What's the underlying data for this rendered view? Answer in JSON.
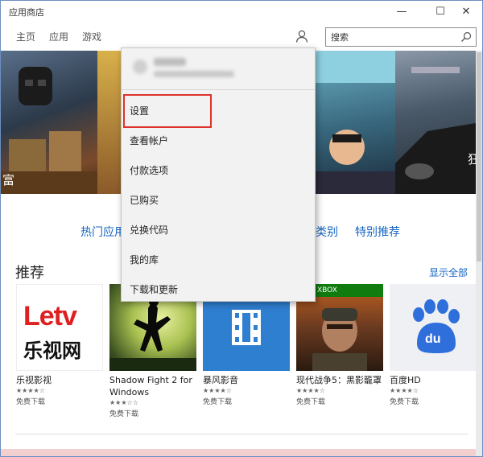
{
  "window": {
    "title": "应用商店",
    "minimize": "—",
    "maximize": "☐",
    "close": "✕"
  },
  "nav": {
    "items": [
      "主页",
      "应用",
      "游戏"
    ],
    "search_placeholder": "搜索"
  },
  "hero": {
    "captions": [
      "富",
      "狂"
    ]
  },
  "categories": {
    "hot": "热门应用",
    "categories": "类别",
    "featured": "特别推荐"
  },
  "recommended": {
    "title": "推荐",
    "show_all": "显示全部",
    "apps": [
      {
        "name": "乐视影视",
        "stars": "★★★★☆",
        "price": "免费下载",
        "logo_top": "Letv",
        "logo_bottom": "乐视网"
      },
      {
        "name": "Shadow Fight 2 for Windows",
        "stars": "★★★☆☆",
        "price": "免费下载"
      },
      {
        "name": "暴风影音",
        "stars": "★★★★☆",
        "price": "免费下载"
      },
      {
        "name": "现代战争5：黑影籠罩",
        "stars": "★★★★☆",
        "price": "免费下载",
        "badge": "XBOX"
      },
      {
        "name": "百度HD",
        "stars": "★★★★☆",
        "price": "免费下载",
        "logo": "du"
      }
    ]
  },
  "menu": {
    "items": [
      "设置",
      "查看帐户",
      "付款选项",
      "已购买",
      "兑换代码",
      "我的库",
      "下载和更新"
    ]
  },
  "colors": {
    "accent_link": "#1565c0",
    "highlight": "#e0322d",
    "xbox_green": "#107c10",
    "baofeng_blue": "#2f7fd0",
    "baidu_blue": "#2f6fdc"
  }
}
